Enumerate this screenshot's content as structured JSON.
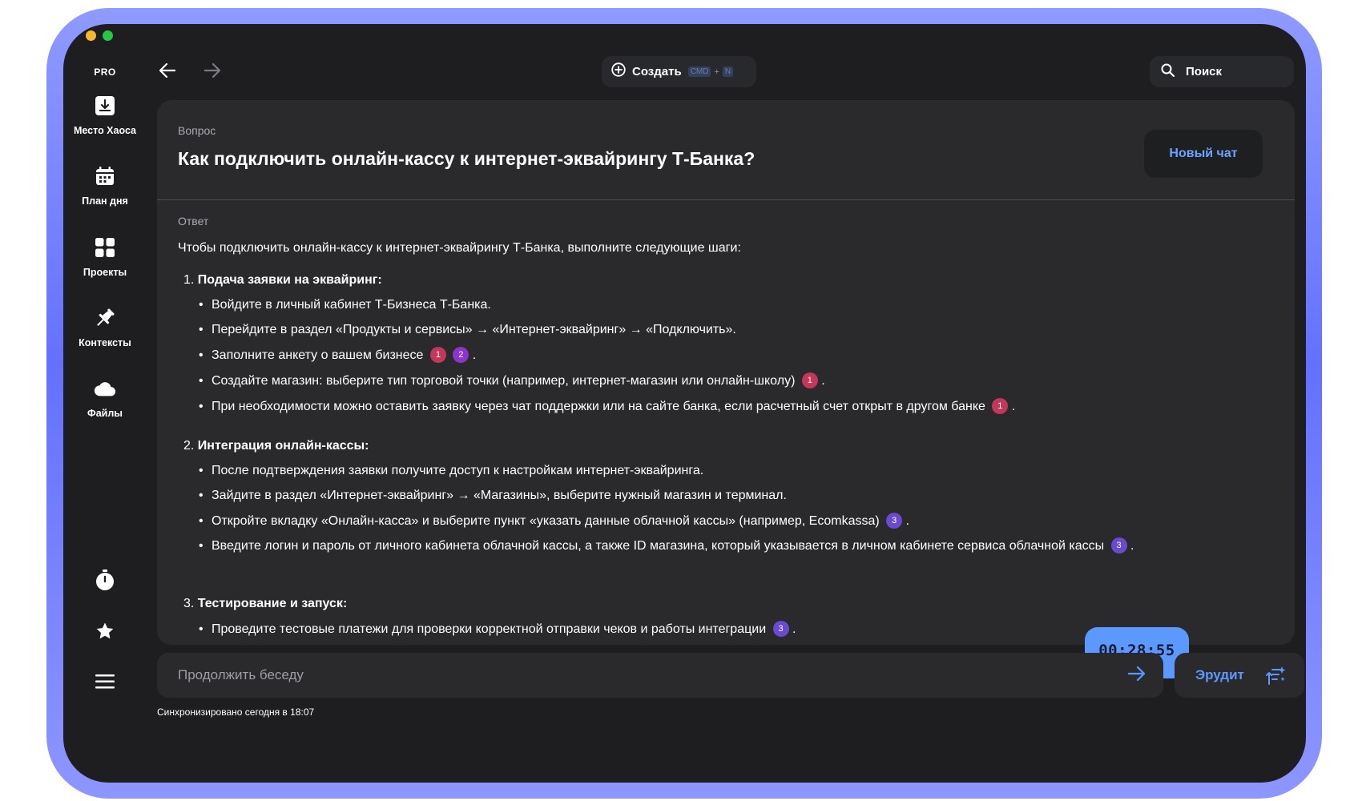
{
  "sidebar": {
    "badge": "PRO",
    "items": [
      {
        "label": "Место Хаоса",
        "icon": "inbox-icon"
      },
      {
        "label": "План дня",
        "icon": "calendar-icon"
      },
      {
        "label": "Проекты",
        "icon": "grid-icon"
      },
      {
        "label": "Контексты",
        "icon": "pin-icon"
      },
      {
        "label": "Файлы",
        "icon": "cloud-icon"
      }
    ],
    "bottom": [
      "timer-icon",
      "star-icon",
      "menu-icon"
    ]
  },
  "topbar": {
    "create_label": "Создать",
    "shortcut_key1": "CMD",
    "shortcut_plus": "+",
    "shortcut_key2": "N",
    "search_label": "Поиск"
  },
  "question": {
    "label": "Вопрос",
    "title": "Как подключить онлайн-кассу к интернет-эквайрингу Т-Банка?",
    "new_chat": "Новый чат"
  },
  "answer": {
    "label": "Ответ",
    "intro": "Чтобы подключить онлайн-кассу к интернет-эквайрингу Т-Банка, выполните следующие шаги:",
    "sections": [
      {
        "num": "1.",
        "title": "Подача заявки на эквайринг:",
        "bullets": [
          "Войдите в личный кабинет Т-Бизнеса Т-Банка.",
          "Перейдите в раздел «Продукты и сервисы» → «Интернет-эквайринг» → «Подключить».",
          "Заполните анкету о вашем бизнесе",
          "Создайте магазин: выберите тип торговой точки (например, интернет-магазин или онлайн-школу)",
          "При необходимости можно оставить заявку через чат поддержки или на сайте банка, если расчетный счет открыт в другом банке"
        ]
      },
      {
        "num": "2.",
        "title": "Интеграция онлайн-кассы:",
        "bullets": [
          "После подтверждения заявки получите доступ к настройкам интернет-эквайринга.",
          "Зайдите в раздел «Интернет-эквайринг» → «Магазины», выберите нужный магазин и терминал.",
          "Откройте вкладку «Онлайн-касса» и выберите пункт «указать данные облачной кассы» (например, Ecomkassa)",
          "Введите логин и пароль от личного кабинета облачной кассы, а также ID магазина, который указывается в личном кабинете сервиса облачной кассы"
        ]
      },
      {
        "num": "3.",
        "title": "Тестирование и запуск:",
        "bullets": [
          "Проведите тестовые платежи для проверки корректной отправки чеков и работы интеграции"
        ]
      }
    ],
    "citations": {
      "c1": "1",
      "c2": "2",
      "c3": "3"
    },
    "period": "."
  },
  "timer": {
    "value": "00:28:55"
  },
  "composer": {
    "placeholder": "Продолжить беседу",
    "model_label": "Эрудит"
  },
  "status": {
    "sync_text": "Синхронизировано сегодня в 18:07"
  },
  "colors": {
    "accent": "#5b98ff",
    "frame": "#6471ff",
    "background": "#1e1e20",
    "panel": "#2a2a2d"
  }
}
